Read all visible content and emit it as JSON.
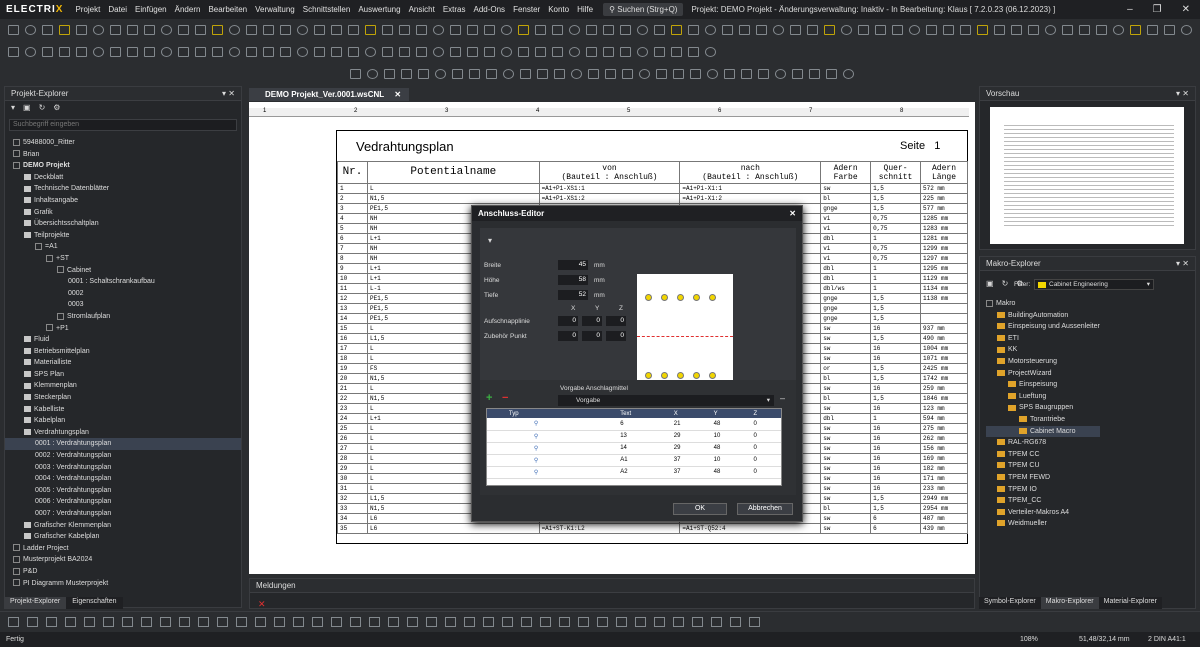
{
  "app": {
    "logo": "ELECTRIX",
    "menu": [
      "Projekt",
      "Datei",
      "Einfügen",
      "Ändern",
      "Bearbeiten",
      "Verwaltung",
      "Schnittstellen",
      "Auswertung",
      "Ansicht",
      "Extras",
      "Add-Ons",
      "Fenster",
      "Konto",
      "Hilfe"
    ],
    "search": "Suchen (Strg+Q)",
    "title": "Projekt: DEMO Projekt - Änderungsverwaltung: Inaktiv - In Bearbeitung: Klaus [ 7.2.0.23 (06.12.2023) ]"
  },
  "left_panel": {
    "title": "Projekt-Explorer",
    "search_placeholder": "Suchbegriff eingeben",
    "tree": [
      {
        "label": "59488000_Ritter",
        "level": 0,
        "type": "folder"
      },
      {
        "label": "Brian",
        "level": 0,
        "type": "folder"
      },
      {
        "label": "DEMO Projekt",
        "level": 0,
        "type": "folder",
        "bold": true
      },
      {
        "label": "Deckblatt",
        "level": 1,
        "type": "file"
      },
      {
        "label": "Technische Datenblätter",
        "level": 1,
        "type": "file"
      },
      {
        "label": "Inhaltsangabe",
        "level": 1,
        "type": "file"
      },
      {
        "label": "Grafik",
        "level": 1,
        "type": "file"
      },
      {
        "label": "Übersichtsschaltplan",
        "level": 1,
        "type": "file"
      },
      {
        "label": "Teilprojekte",
        "level": 1,
        "type": "file"
      },
      {
        "label": "=A1",
        "level": 2,
        "type": "folder"
      },
      {
        "label": "+ST",
        "level": 3,
        "type": "folder"
      },
      {
        "label": "Cabinet",
        "level": 4,
        "type": "folder"
      },
      {
        "label": "0001 : Schaltschrankaufbau",
        "level": 5,
        "type": "page"
      },
      {
        "label": "0002",
        "level": 5,
        "type": "page"
      },
      {
        "label": "0003",
        "level": 5,
        "type": "page"
      },
      {
        "label": "Stromlaufplan",
        "level": 4,
        "type": "folder"
      },
      {
        "label": "+P1",
        "level": 3,
        "type": "folder"
      },
      {
        "label": "Fluid",
        "level": 1,
        "type": "file"
      },
      {
        "label": "Betriebsmittelplan",
        "level": 1,
        "type": "file"
      },
      {
        "label": "Materialliste",
        "level": 1,
        "type": "file"
      },
      {
        "label": "SPS Plan",
        "level": 1,
        "type": "file"
      },
      {
        "label": "Klemmenplan",
        "level": 1,
        "type": "file"
      },
      {
        "label": "Steckerplan",
        "level": 1,
        "type": "file"
      },
      {
        "label": "Kabelliste",
        "level": 1,
        "type": "file"
      },
      {
        "label": "Kabelplan",
        "level": 1,
        "type": "file"
      },
      {
        "label": "Verdrahtungsplan",
        "level": 1,
        "type": "file"
      },
      {
        "label": "0001 : Verdrahtungsplan",
        "level": 2,
        "type": "page",
        "selected": true
      },
      {
        "label": "0002 : Verdrahtungsplan",
        "level": 2,
        "type": "page"
      },
      {
        "label": "0003 : Verdrahtungsplan",
        "level": 2,
        "type": "page"
      },
      {
        "label": "0004 : Verdrahtungsplan",
        "level": 2,
        "type": "page"
      },
      {
        "label": "0005 : Verdrahtungsplan",
        "level": 2,
        "type": "page"
      },
      {
        "label": "0006 : Verdrahtungsplan",
        "level": 2,
        "type": "page"
      },
      {
        "label": "0007 : Verdrahtungsplan",
        "level": 2,
        "type": "page"
      },
      {
        "label": "Grafischer Klemmenplan",
        "level": 1,
        "type": "file"
      },
      {
        "label": "Grafischer Kabelplan",
        "level": 1,
        "type": "file"
      },
      {
        "label": "Ladder Project",
        "level": 0,
        "type": "folder"
      },
      {
        "label": "Musterprojekt BA2024",
        "level": 0,
        "type": "folder"
      },
      {
        "label": "P&D",
        "level": 0,
        "type": "folder"
      },
      {
        "label": "PI Diagramm Musterprojekt",
        "level": 0,
        "type": "folder"
      }
    ],
    "tabs": [
      "Projekt-Explorer",
      "Eigenschaften"
    ]
  },
  "document": {
    "tab": "DEMO Projekt_Ver.0001.wsCNL",
    "ruler": [
      "1",
      "2",
      "3",
      "4",
      "5",
      "6",
      "7",
      "8"
    ],
    "title": "Vedrahtungsplan",
    "page_label": "Seite",
    "page_number": "1",
    "headers": {
      "nr": "Nr.",
      "potential": "Potentialname",
      "von": "von",
      "von_sub": "(Bauteil : Anschluß)",
      "nach": "nach",
      "nach_sub": "(Bauteil : Anschluß)",
      "farbe": "Adern Farbe",
      "querschnitt": "Quer- schnitt",
      "laenge": "Adern Länge"
    },
    "rows": [
      [
        "1",
        "L",
        "=A1+P1-XS1:1",
        "=A1+P1-X1:1",
        "sw",
        "1,5",
        "572 mm"
      ],
      [
        "2",
        "N1,5",
        "=A1+P1-XS1:2",
        "=A1+P1-X1:2",
        "bl",
        "1,5",
        "225 mm"
      ],
      [
        "3",
        "PE1,5",
        "",
        "",
        "gnge",
        "1,5",
        "577 mm"
      ],
      [
        "4",
        "NH",
        "",
        "",
        "vi",
        "0,75",
        "1285 mm"
      ],
      [
        "5",
        "NH",
        "",
        "",
        "vi",
        "0,75",
        "1283 mm"
      ],
      [
        "6",
        "L+1",
        "",
        "",
        "dbl",
        "1",
        "1281 mm"
      ],
      [
        "7",
        "NH",
        "",
        "",
        "vi",
        "0,75",
        "1299 mm"
      ],
      [
        "8",
        "NH",
        "",
        "",
        "vi",
        "0,75",
        "1297 mm"
      ],
      [
        "9",
        "L+1",
        "",
        "",
        "dbl",
        "1",
        "1295 mm"
      ],
      [
        "10",
        "L+1",
        "",
        "",
        "dbl",
        "1",
        "1129 mm"
      ],
      [
        "11",
        "L-1",
        "",
        "",
        "dbl/ws",
        "1",
        "1134 mm"
      ],
      [
        "12",
        "PE1,5",
        "",
        "",
        "gnge",
        "1,5",
        "1138 mm"
      ],
      [
        "13",
        "PE1,5",
        "",
        "",
        "gnge",
        "1,5",
        ""
      ],
      [
        "14",
        "PE1,5",
        "",
        "",
        "gnge",
        "1,5",
        ""
      ],
      [
        "15",
        "L",
        "",
        "",
        "sw",
        "16",
        "937 mm"
      ],
      [
        "16",
        "L1,5",
        "",
        "",
        "sw",
        "1,5",
        "490 mm"
      ],
      [
        "17",
        "L",
        "",
        "",
        "sw",
        "16",
        "1004 mm"
      ],
      [
        "18",
        "L",
        "",
        "",
        "sw",
        "16",
        "1071 mm"
      ],
      [
        "19",
        "FS",
        "",
        "",
        "or",
        "1,5",
        "2425 mm"
      ],
      [
        "20",
        "N1,5",
        "",
        "",
        "bl",
        "1,5",
        "1742 mm"
      ],
      [
        "21",
        "L",
        "",
        "",
        "sw",
        "16",
        "259 mm"
      ],
      [
        "22",
        "N1,5",
        "",
        "",
        "bl",
        "1,5",
        "1846 mm"
      ],
      [
        "23",
        "L",
        "",
        "",
        "sw",
        "16",
        "123 mm"
      ],
      [
        "24",
        "L+1",
        "",
        "",
        "dbl",
        "1",
        "594 mm"
      ],
      [
        "25",
        "L",
        "",
        "",
        "sw",
        "16",
        "275 mm"
      ],
      [
        "26",
        "L",
        "",
        "",
        "sw",
        "16",
        "262 mm"
      ],
      [
        "27",
        "L",
        "",
        "",
        "sw",
        "16",
        "156 mm"
      ],
      [
        "28",
        "L",
        "",
        "",
        "sw",
        "16",
        "169 mm"
      ],
      [
        "29",
        "L",
        "",
        "",
        "sw",
        "16",
        "182 mm"
      ],
      [
        "30",
        "L",
        "",
        "",
        "sw",
        "16",
        "171 mm"
      ],
      [
        "31",
        "L",
        "",
        "",
        "sw",
        "16",
        "233 mm"
      ],
      [
        "32",
        "L1,5",
        "",
        "",
        "sw",
        "1,5",
        "2949 mm"
      ],
      [
        "33",
        "N1,5",
        "",
        "",
        "bl",
        "1,5",
        "2954 mm"
      ],
      [
        "34",
        "L6",
        "=A1+ST-K1:L1",
        "=A1+ST-Q52:2",
        "sw",
        "6",
        "487 mm"
      ],
      [
        "35",
        "L6",
        "=A1+ST-K1:L2",
        "=A1+ST-Q52:4",
        "sw",
        "6",
        "439 mm"
      ]
    ]
  },
  "dialog": {
    "title": "Anschluss-Editor",
    "breite_label": "Breite",
    "breite": "45",
    "hoehe_label": "Höhe",
    "hoehe": "58",
    "tiefe_label": "Tiefe",
    "tiefe": "52",
    "unit": "mm",
    "x": "X",
    "y": "Y",
    "z": "Z",
    "aufschnapp_label": "Aufschnapplinie",
    "zubehoer_label": "Zubehör Punkt",
    "zero": "0",
    "pins_top": [
      "1",
      "2",
      "3",
      "4",
      "5"
    ],
    "pins_bottom": [
      "6",
      "7",
      "8",
      "9",
      "10"
    ],
    "vorgabe_label": "Vorgabe Anschlagmittel",
    "vorgabe_value": "Vorgabe",
    "grid_headers": [
      "",
      "Typ",
      "Text",
      "X",
      "Y",
      "Z"
    ],
    "grid_rows": [
      [
        "6",
        "21",
        "48",
        "0"
      ],
      [
        "13",
        "29",
        "10",
        "0"
      ],
      [
        "14",
        "29",
        "48",
        "0"
      ],
      [
        "A1",
        "37",
        "10",
        "0"
      ],
      [
        "A2",
        "37",
        "48",
        "0"
      ]
    ],
    "ok": "OK",
    "cancel": "Abbrechen"
  },
  "messages": {
    "title": "Meldungen"
  },
  "preview": {
    "title": "Vorschau"
  },
  "macro": {
    "title": "Makro-Explorer",
    "filter_label": "Filter:",
    "filter_value": "Cabinet Engineering",
    "tree": [
      {
        "label": "Makro",
        "level": 0
      },
      {
        "label": "BuildingAutomation",
        "level": 1
      },
      {
        "label": "Einspeisung und Aussenleiter",
        "level": 1
      },
      {
        "label": "ETI",
        "level": 1
      },
      {
        "label": "KK",
        "level": 1
      },
      {
        "label": "Motorsteuerung",
        "level": 1
      },
      {
        "label": "ProjectWizard",
        "level": 1
      },
      {
        "label": "Einspeisung",
        "level": 2
      },
      {
        "label": "Lueftung",
        "level": 2
      },
      {
        "label": "SPS Baugruppen",
        "level": 2
      },
      {
        "label": "Torantriebe",
        "level": 3
      },
      {
        "label": "Cabinet Macro",
        "level": 3,
        "selected": true
      },
      {
        "label": "RAL-RG678",
        "level": 1
      },
      {
        "label": "TPEM CC",
        "level": 1
      },
      {
        "label": "TPEM CU",
        "level": 1
      },
      {
        "label": "TPEM FEWD",
        "level": 1
      },
      {
        "label": "TPEM IO",
        "level": 1
      },
      {
        "label": "TPEM_CC",
        "level": 1
      },
      {
        "label": "Verteiler-Makros A4",
        "level": 1
      },
      {
        "label": "Weidmueller",
        "level": 1
      }
    ],
    "tabs": [
      "Symbol-Explorer",
      "Makro-Explorer",
      "Material-Explorer"
    ]
  },
  "bottom_toolbar": {
    "style": "Standard"
  },
  "status": {
    "left": "Fertig",
    "zoom": "108%",
    "coords": "51,48/32,14 mm",
    "sheet": "2 DIN A4",
    "page": "1:1"
  },
  "colors": {
    "accent": "#f2b705",
    "bg": "#2b2d30",
    "grid_header": "#3b4b6b"
  }
}
